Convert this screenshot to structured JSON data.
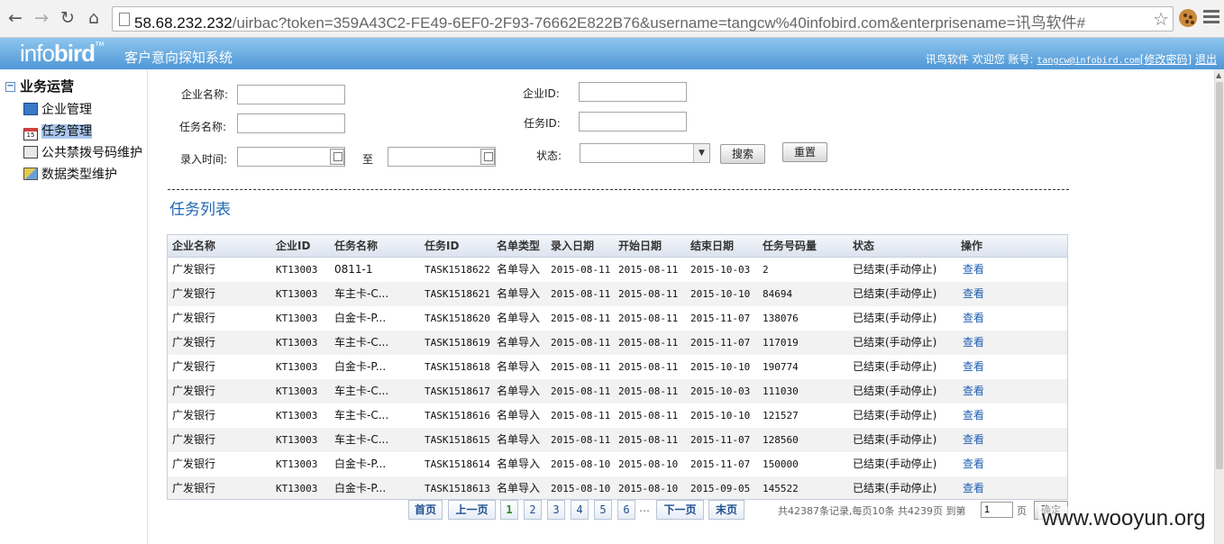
{
  "browser": {
    "url_host": "58.68.232.232",
    "url_rest": "/uirbac?token=359A43C2-FE49-6EF0-2F93-76662E822B76&username=tangcw%40infobird.com&enterprisename=讯鸟软件#"
  },
  "header": {
    "logo_light": "info",
    "logo_bold": "bird",
    "logo_tm": "™",
    "system_name": "客户意向探知系统",
    "company": "讯鸟软件",
    "welcome": "欢迎您 账号:",
    "email": "tangcw@infobird.com",
    "change_password": "修改密码",
    "logout": "退出"
  },
  "sidebar": {
    "root": "业务运营",
    "items": [
      {
        "label": "企业管理",
        "icon": "monitor-icon"
      },
      {
        "label": "任务管理",
        "icon": "calendar-icon",
        "active": true
      },
      {
        "label": "公共禁拨号码维护",
        "icon": "phone-list-icon"
      },
      {
        "label": "数据类型维护",
        "icon": "data-type-icon"
      }
    ]
  },
  "search": {
    "company_name_label": "企业名称:",
    "company_id_label": "企业ID:",
    "task_name_label": "任务名称:",
    "task_id_label": "任务ID:",
    "entry_time_label": "录入时间:",
    "to_label": "至",
    "status_label": "状态:",
    "search_button": "搜索",
    "reset_button": "重置"
  },
  "section_title": "任务列表",
  "table": {
    "headers": [
      "企业名称",
      "企业ID",
      "任务名称",
      "任务ID",
      "名单类型",
      "录入日期",
      "开始日期",
      "结束日期",
      "任务号码量",
      "状态",
      "操作"
    ],
    "rows": [
      [
        "广发银行",
        "KT13003",
        "0811-1",
        "TASK1518622",
        "名单导入",
        "2015-08-11",
        "2015-08-11",
        "2015-10-03",
        "2",
        "已结束(手动停止)",
        "查看"
      ],
      [
        "广发银行",
        "KT13003",
        "车主卡-C...",
        "TASK1518621",
        "名单导入",
        "2015-08-11",
        "2015-08-11",
        "2015-10-10",
        "84694",
        "已结束(手动停止)",
        "查看"
      ],
      [
        "广发银行",
        "KT13003",
        "白金卡-P...",
        "TASK1518620",
        "名单导入",
        "2015-08-11",
        "2015-08-11",
        "2015-11-07",
        "138076",
        "已结束(手动停止)",
        "查看"
      ],
      [
        "广发银行",
        "KT13003",
        "车主卡-C...",
        "TASK1518619",
        "名单导入",
        "2015-08-11",
        "2015-08-11",
        "2015-11-07",
        "117019",
        "已结束(手动停止)",
        "查看"
      ],
      [
        "广发银行",
        "KT13003",
        "白金卡-P...",
        "TASK1518618",
        "名单导入",
        "2015-08-11",
        "2015-08-11",
        "2015-10-10",
        "190774",
        "已结束(手动停止)",
        "查看"
      ],
      [
        "广发银行",
        "KT13003",
        "车主卡-C...",
        "TASK1518617",
        "名单导入",
        "2015-08-11",
        "2015-08-11",
        "2015-10-03",
        "111030",
        "已结束(手动停止)",
        "查看"
      ],
      [
        "广发银行",
        "KT13003",
        "车主卡-C...",
        "TASK1518616",
        "名单导入",
        "2015-08-11",
        "2015-08-11",
        "2015-10-10",
        "121527",
        "已结束(手动停止)",
        "查看"
      ],
      [
        "广发银行",
        "KT13003",
        "车主卡-C...",
        "TASK1518615",
        "名单导入",
        "2015-08-11",
        "2015-08-11",
        "2015-11-07",
        "128560",
        "已结束(手动停止)",
        "查看"
      ],
      [
        "广发银行",
        "KT13003",
        "白金卡-P...",
        "TASK1518614",
        "名单导入",
        "2015-08-10",
        "2015-08-10",
        "2015-11-07",
        "150000",
        "已结束(手动停止)",
        "查看"
      ],
      [
        "广发银行",
        "KT13003",
        "白金卡-P...",
        "TASK1518613",
        "名单导入",
        "2015-08-10",
        "2015-08-10",
        "2015-09-05",
        "145522",
        "已结束(手动停止)",
        "查看"
      ]
    ]
  },
  "pager": {
    "first": "首页",
    "prev": "上一页",
    "pages": [
      "1",
      "2",
      "3",
      "4",
      "5",
      "6"
    ],
    "current": "1",
    "ellipsis": "…",
    "next": "下一页",
    "last": "末页",
    "info": "共42387条记录,每页10条 共4239页 到第",
    "goto_value": "1",
    "page_unit": "页",
    "confirm": "确定"
  },
  "watermark": "www.wooyun.org"
}
